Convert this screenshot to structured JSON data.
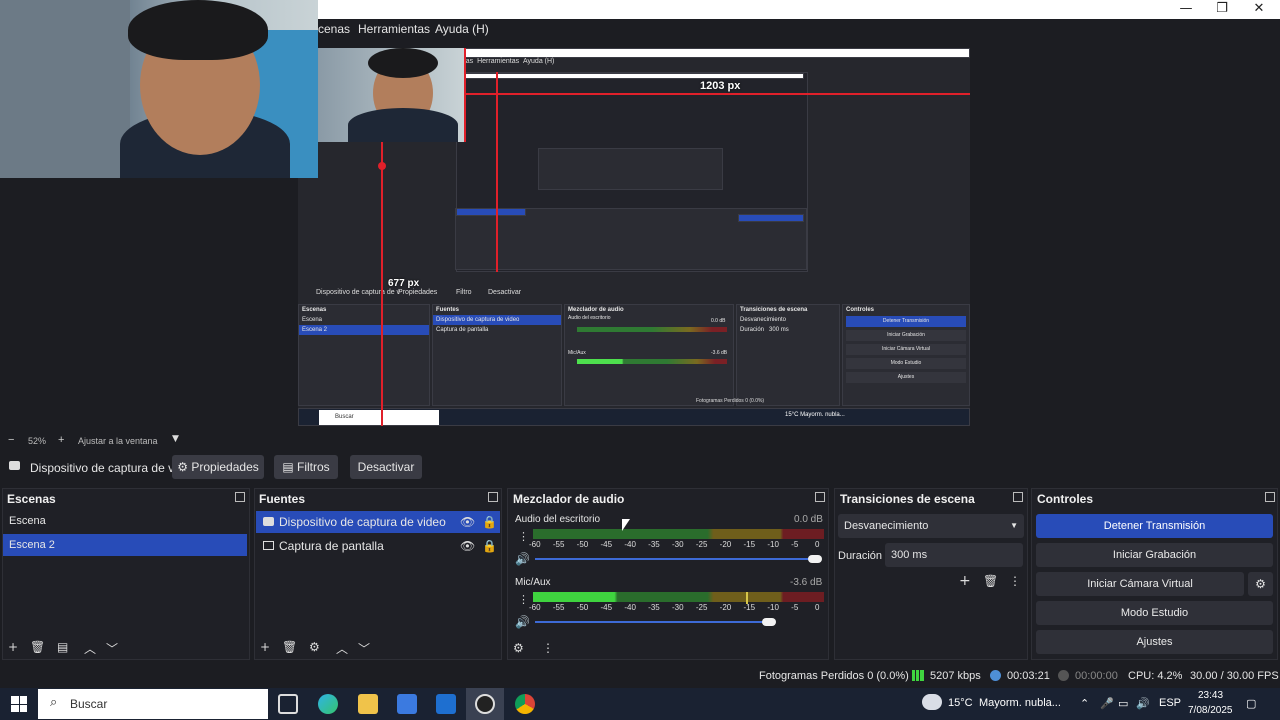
{
  "window": {
    "minimize": "—",
    "maximize": "❐",
    "close": "✕"
  },
  "menu": [
    "cenas",
    "Herramientas",
    "Ayuda (H)"
  ],
  "preview": {
    "width_label": "1203 px",
    "height_label": "677 px",
    "nested_menu": [
      "enas",
      "Herramientas",
      "Ayuda (H)"
    ],
    "nested_source": "Dispositivo de captura de v",
    "nested_buttons": [
      "Propiedades",
      "Filtro",
      "Desactivar"
    ],
    "nested_docks": [
      "Escenas",
      "Fuentes",
      "Mezclador de audio",
      "Transiciones de escena",
      "Controles"
    ],
    "nested_scenes": [
      "Escena",
      "Escena 2"
    ],
    "nested_sources": [
      "Dispositivo de captura de video",
      "Captura de pantalla"
    ],
    "nested_controls": [
      "Detener Transmisión",
      "Iniciar Grabación",
      "Iniciar Cámara Virtual",
      "Modo Estudio",
      "Ajustes"
    ],
    "nested_mixer": [
      "Audio del escritorio",
      "Mic/Aux"
    ],
    "nested_db": [
      "0.0 dB",
      "-3.6 dB"
    ],
    "nested_transition": "Desvanecimiento",
    "nested_duration_label": "Duración",
    "nested_duration": "300 ms",
    "nested_status": "Fotogramas Perdidos 0 (0.0%)",
    "nested_search": "Buscar",
    "nested_weather": "15°C  Mayorm. nubla..."
  },
  "zoom": {
    "minus": "−",
    "level": "52%",
    "plus": "+",
    "fit": "Ajustar a la ventana"
  },
  "source_toolbar": {
    "source_name": "Dispositivo de captura de v",
    "properties": "Propiedades",
    "filters": "Filtros",
    "deactivate": "Desactivar"
  },
  "docks": {
    "scenes": {
      "title": "Escenas",
      "items": [
        "Escena",
        "Escena 2"
      ],
      "selected": 1
    },
    "sources": {
      "title": "Fuentes",
      "items": [
        "Dispositivo de captura de video",
        "Captura de pantalla"
      ],
      "selected": 0
    },
    "mixer": {
      "title": "Mezclador de audio",
      "channels": [
        {
          "name": "Audio del escritorio",
          "db": "0.0 dB",
          "volume": 1.0
        },
        {
          "name": "Mic/Aux",
          "db": "-3.6 dB",
          "volume": 0.8
        }
      ],
      "ticks": [
        "-60",
        "-55",
        "-50",
        "-45",
        "-40",
        "-35",
        "-30",
        "-25",
        "-20",
        "-15",
        "-10",
        "-5",
        "0"
      ]
    },
    "transitions": {
      "title": "Transiciones de escena",
      "type": "Desvanecimiento",
      "duration_label": "Duración",
      "duration": "300 ms"
    },
    "controls": {
      "title": "Controles",
      "stop_stream": "Detener Transmisión",
      "start_record": "Iniciar Grabación",
      "virtual_cam": "Iniciar Cámara Virtual",
      "studio": "Modo Estudio",
      "settings": "Ajustes"
    }
  },
  "status": {
    "dropped": "Fotogramas Perdidos 0 (0.0%)",
    "bitrate": "5207 kbps",
    "stream_time": "00:03:21",
    "record_time": "00:00:00",
    "cpu": "CPU: 4.2%",
    "fps": "30.00 / 30.00 FPS"
  },
  "taskbar": {
    "search": "Buscar",
    "weather": "15°C",
    "weather_desc": "Mayorm. nubla...",
    "lang": "ESP",
    "time": "23:43",
    "date": "7/08/2025"
  },
  "colors": {
    "accent": "#284cb8",
    "selection": "#e0202a",
    "background": "#1c1d22"
  }
}
